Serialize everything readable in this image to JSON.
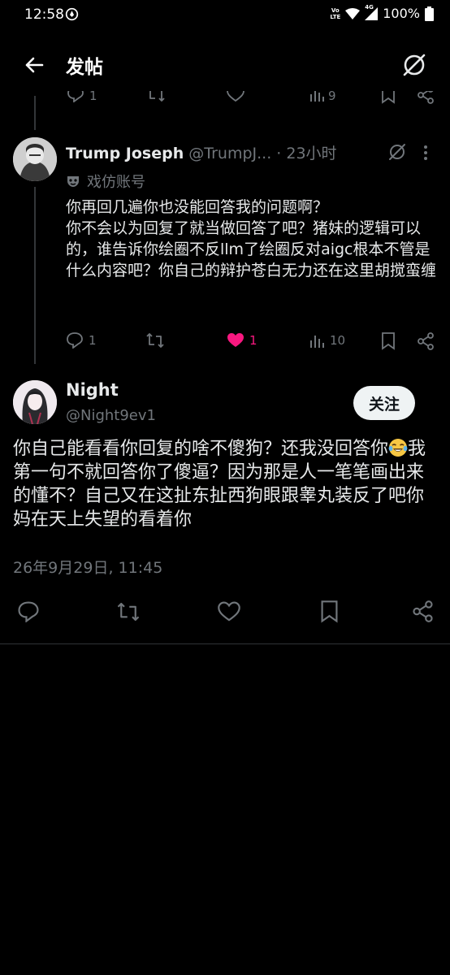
{
  "status_bar": {
    "time": "12:58",
    "network_label": "Vo\nLTE",
    "signal_type": "4G",
    "battery": "100%"
  },
  "header": {
    "title": "发帖"
  },
  "previous_tweet_actions": {
    "reply_count": "1",
    "views_count": "9"
  },
  "reply": {
    "display_name": "Trump Joseph",
    "handle": "@TrumpJ...",
    "time": "· 23小时",
    "label": "戏仿账号",
    "text": "你再回几遍你也没能回答我的问题啊？\n你不会以为回复了就当做回答了吧？猪妹的逻辑可以的，谁告诉你绘圈不反llm了绘圈反对aigc根本不管是什么内容吧？你自己的辩护苍白无力还在这里胡搅蛮缠",
    "actions": {
      "reply_count": "1",
      "like_count": "1",
      "views_count": "10"
    }
  },
  "main_tweet": {
    "display_name": "Night",
    "handle": "@Night9ev1",
    "follow_label": "关注",
    "text_part1": "你自己能看看你回复的啥不傻狗？还我没回答你",
    "text_part2": "我第一句不就回答你了傻逼？因为那是人一笔笔画出来的懂不？自己又在这扯东扯西狗眼跟睾丸装反了吧你妈在天上失望的看着你",
    "timestamp": "26年9月29日, 11:45"
  },
  "colors": {
    "background": "#000000",
    "text_primary": "#e7e9ea",
    "text_secondary": "#71767b",
    "like_pink": "#f91880",
    "divider": "#2f3336"
  },
  "icons": {
    "back": "arrow-left-icon",
    "grok": "grok-icon",
    "more": "more-dots-icon",
    "parody": "mask-icon",
    "reply": "speech-bubble-icon",
    "repost": "repost-icon",
    "like": "heart-icon",
    "views": "bar-chart-icon",
    "bookmark": "bookmark-icon",
    "share": "share-icon",
    "emoji": "tears-of-joy-emoji"
  }
}
